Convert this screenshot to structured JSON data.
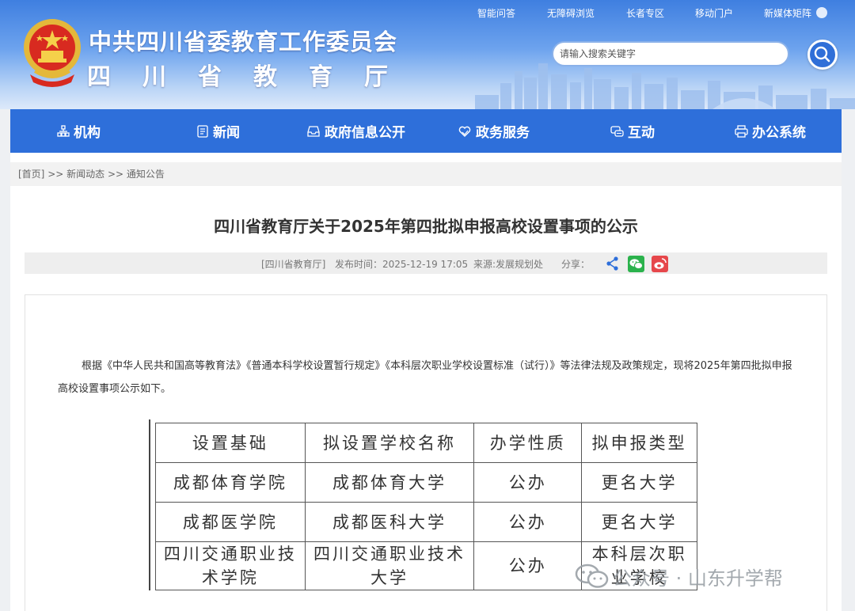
{
  "header": {
    "org_name": "中共四川省委教育工作委员会",
    "dept_name": "四川省教育厅",
    "top_links": [
      "智能问答",
      "无障碍浏览",
      "长者专区",
      "移动门户",
      "新媒体矩阵"
    ],
    "search_placeholder": "请输入搜索关键字"
  },
  "nav": {
    "items": [
      {
        "label": "机构",
        "icon": "building-icon"
      },
      {
        "label": "新闻",
        "icon": "newspaper-icon"
      },
      {
        "label": "政府信息公开",
        "icon": "inbox-icon"
      },
      {
        "label": "政务服务",
        "icon": "heart-hand-icon"
      },
      {
        "label": "互动",
        "icon": "chat-icon"
      },
      {
        "label": "办公系统",
        "icon": "printer-icon"
      }
    ]
  },
  "breadcrumb": {
    "home": "[首页]",
    "sep": ">>",
    "items": [
      "新闻动态",
      "通知公告"
    ]
  },
  "article": {
    "title": "四川省教育厅关于2025年第四批拟申报高校设置事项的公示",
    "source": "[四川省教育厅]",
    "publish_time": "发布时间：2025-12-19 17:05",
    "origin": "来源:发展规划处",
    "share_label": "分享：",
    "paragraph": "根据《中华人民共和国高等教育法》《普通本科学校设置暂行规定》《本科层次职业学校设置标准（试行）》等法律法规及政策规定，现将2025年第四批拟申报高校设置事项公示如下。"
  },
  "table": {
    "headers": [
      "设置基础",
      "拟设置学校名称",
      "办学性质",
      "拟申报类型"
    ],
    "rows": [
      [
        "成都体育学院",
        "成都体育大学",
        "公办",
        "更名大学"
      ],
      [
        "成都医学院",
        "成都医科大学",
        "公办",
        "更名大学"
      ],
      [
        "四川交通职业技术学院",
        "四川交通职业技术大学",
        "公办",
        "本科层次职业学校"
      ]
    ]
  },
  "watermark": {
    "text": "公众号 · 山东升学帮"
  },
  "colors": {
    "nav_bg": "#2e6fda",
    "header_top": "#3f7fe0",
    "wechat": "#2bb24c",
    "weibo": "#e6474b",
    "share": "#2e6fda"
  }
}
